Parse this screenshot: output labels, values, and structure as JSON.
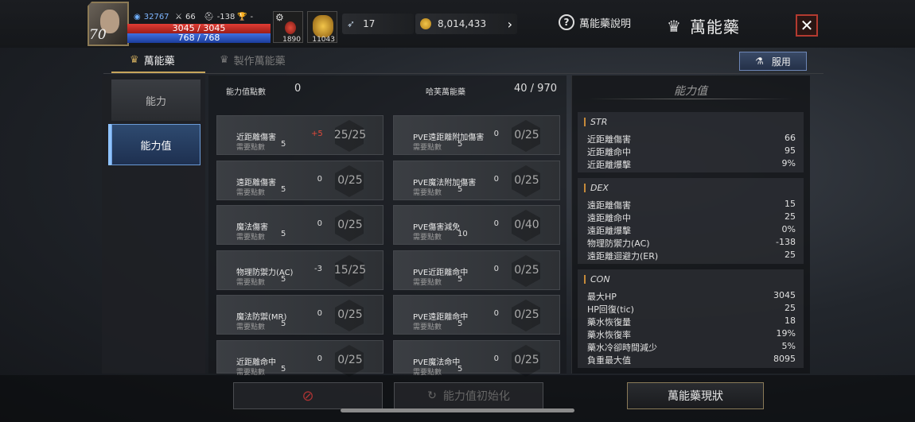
{
  "player": {
    "level": "70",
    "exp": "32767",
    "stat_a": "66",
    "stat_b": "-138",
    "stat_c": "-",
    "hp": "3045 / 3045",
    "mp": "768 / 768",
    "slot1_qty": "1890",
    "slot2_qty": "11043"
  },
  "currency": {
    "feathers": "17",
    "gold": "8,014,433"
  },
  "header": {
    "help_label": "萬能藥說明",
    "title": "萬能藥",
    "close_label": "✕"
  },
  "tabs": [
    {
      "label": "萬能藥"
    },
    {
      "label": "製作萬能藥"
    }
  ],
  "use_button": "服用",
  "nav": [
    {
      "label": "能力"
    },
    {
      "label": "能力值"
    }
  ],
  "points": {
    "label": "能力值點數",
    "value": "0"
  },
  "elixir": {
    "label": "哈芙萬能藥",
    "value": "40 / 970"
  },
  "cards_left": [
    {
      "name": "近距離傷害",
      "req_label": "需要點數",
      "req": "5",
      "bonus": "+5",
      "progress": "25/25"
    },
    {
      "name": "遠距離傷害",
      "req_label": "需要點數",
      "req": "5",
      "bonus": "0",
      "progress": "0/25"
    },
    {
      "name": "魔法傷害",
      "req_label": "需要點數",
      "req": "5",
      "bonus": "0",
      "progress": "0/25"
    },
    {
      "name": "物理防禦力(AC)",
      "req_label": "需要點數",
      "req": "5",
      "bonus": "-3",
      "progress": "15/25"
    },
    {
      "name": "魔法防禦(MR)",
      "req_label": "需要點數",
      "req": "5",
      "bonus": "0",
      "progress": "0/25"
    },
    {
      "name": "近距離命中",
      "req_label": "需要點數",
      "req": "5",
      "bonus": "0",
      "progress": "0/25"
    }
  ],
  "cards_right": [
    {
      "name": "PVE遠距離附加傷害",
      "req_label": "需要點數",
      "req": "5",
      "bonus": "0",
      "progress": "0/25"
    },
    {
      "name": "PVE魔法附加傷害",
      "req_label": "需要點數",
      "req": "5",
      "bonus": "0",
      "progress": "0/25"
    },
    {
      "name": "PVE傷害減免",
      "req_label": "需要點數",
      "req": "10",
      "bonus": "0",
      "progress": "0/40"
    },
    {
      "name": "PVE近距離命中",
      "req_label": "需要點數",
      "req": "5",
      "bonus": "0",
      "progress": "0/25"
    },
    {
      "name": "PVE遠距離命中",
      "req_label": "需要點數",
      "req": "5",
      "bonus": "0",
      "progress": "0/25"
    },
    {
      "name": "PVE魔法命中",
      "req_label": "需要點數",
      "req": "5",
      "bonus": "0",
      "progress": "0/25"
    }
  ],
  "stats_panel": {
    "title": "能力值",
    "str": {
      "header": "STR",
      "rows": [
        {
          "k": "近距離傷害",
          "v": "66"
        },
        {
          "k": "近距離命中",
          "v": "95"
        },
        {
          "k": "近距離爆擊",
          "v": "9%"
        }
      ]
    },
    "dex": {
      "header": "DEX",
      "rows": [
        {
          "k": "遠距離傷害",
          "v": "15"
        },
        {
          "k": "遠距離命中",
          "v": "25"
        },
        {
          "k": "遠距離爆擊",
          "v": "0%"
        },
        {
          "k": "物理防禦力(AC)",
          "v": "-138"
        },
        {
          "k": "遠距離迴避力(ER)",
          "v": "25"
        }
      ]
    },
    "con": {
      "header": "CON",
      "rows": [
        {
          "k": "最大HP",
          "v": "3045"
        },
        {
          "k": "HP回復(tic)",
          "v": "25"
        },
        {
          "k": "藥水恢復量",
          "v": "18"
        },
        {
          "k": "藥水恢復率",
          "v": "19%"
        },
        {
          "k": "藥水冷卻時間減少",
          "v": "5%"
        },
        {
          "k": "負重最大值",
          "v": "8095"
        }
      ]
    }
  },
  "bottom": {
    "reset": "能力值初始化",
    "status": "萬能藥現狀"
  },
  "colors": {
    "accent_gold": "#c7a55b",
    "hp_red": "#e13c34",
    "mp_blue": "#3d6fe0",
    "bonus_red": "#e04a3a",
    "close_red": "#b33a30"
  }
}
